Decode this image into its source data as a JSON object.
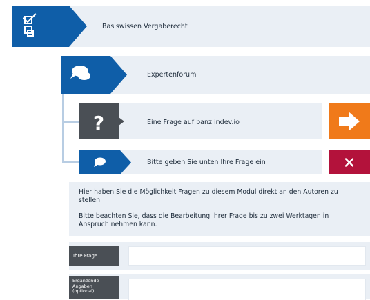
{
  "module": {
    "title": "Basiswissen Vergaberecht",
    "icon": "checklist-icon"
  },
  "forum": {
    "title": "Expertenforum",
    "icon": "speech-bubbles-icon"
  },
  "question_row": {
    "title": "Eine Frage auf banz.indev.io",
    "icon": "question-mark-icon",
    "action_icon": "arrow-right-icon"
  },
  "input_row": {
    "title": "Bitte geben Sie unten Ihre Frage ein",
    "icon": "speech-bubble-icon",
    "close_icon": "close-icon"
  },
  "info": {
    "line1": "Hier haben Sie die Möglichkeit Fragen zu diesem Modul direkt an den Autoren zu stellen.",
    "line2": "Bitte beachten Sie, dass die Bearbeitung Ihrer Frage bis zu zwei Werktagen in Anspruch nehmen kann."
  },
  "form": {
    "question_label": "Ihre Frage",
    "extra_label": "Ergänzende Angaben (optional)"
  },
  "colors": {
    "blue": "#0f5ea8",
    "orange": "#f07a1a",
    "red": "#b3123b",
    "dark": "#4a4f55",
    "panel": "#eaeff5"
  }
}
